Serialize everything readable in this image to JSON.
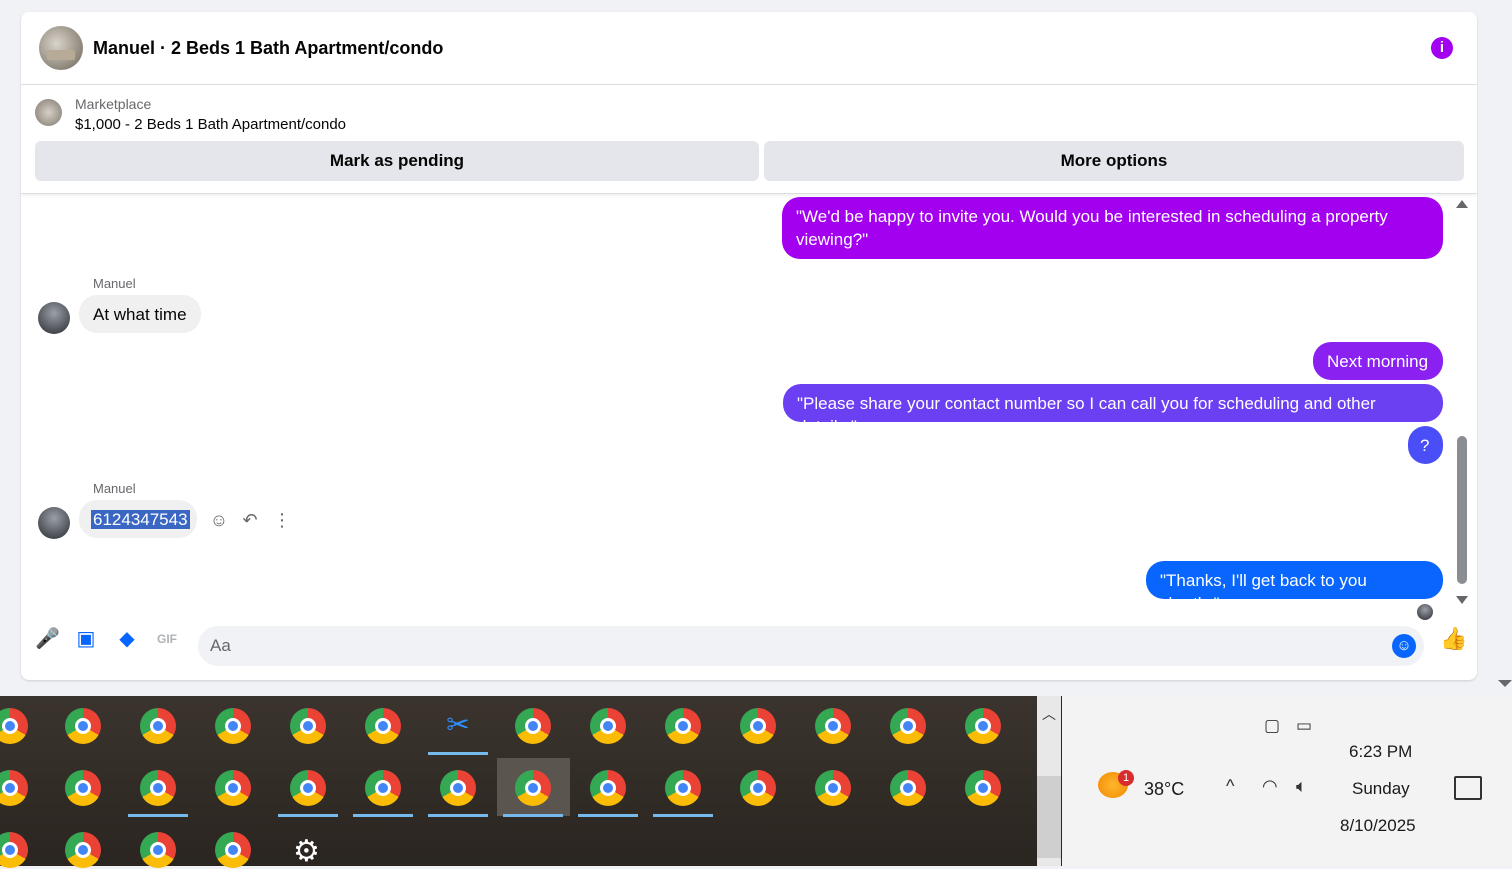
{
  "chat": {
    "title": "Manuel · 2 Beds 1 Bath Apartment/condo",
    "info_icon": "info-icon",
    "listing": {
      "label": "Marketplace",
      "title": "$1,000 - 2 Beds 1 Bath Apartment/condo",
      "btn_pending": "Mark as pending",
      "btn_more": "More options"
    },
    "messages": [
      {
        "from": "me",
        "text": "\"We'd be happy to invite you. Would you be interested in scheduling a property viewing?\""
      },
      {
        "from": "Manuel",
        "sender": "Manuel",
        "text": "At what time"
      },
      {
        "from": "me",
        "text": "Next morning"
      },
      {
        "from": "me",
        "text": "\"Please share your contact number so I can call you for scheduling and other details.\""
      },
      {
        "from": "me",
        "text": "?"
      },
      {
        "from": "Manuel",
        "sender": "Manuel",
        "text": "6124347543"
      },
      {
        "from": "me",
        "text": "\"Thanks, I'll get back to you shortly.\""
      }
    ],
    "composer": {
      "placeholder": "Aa"
    }
  },
  "taskbar": {
    "weather_temp": "38°C",
    "weather_badge": "1",
    "time": "6:23 PM",
    "day": "Sunday",
    "date": "8/10/2025"
  },
  "colors": {
    "accent": "#0866ff",
    "purple": "#a400f0"
  }
}
